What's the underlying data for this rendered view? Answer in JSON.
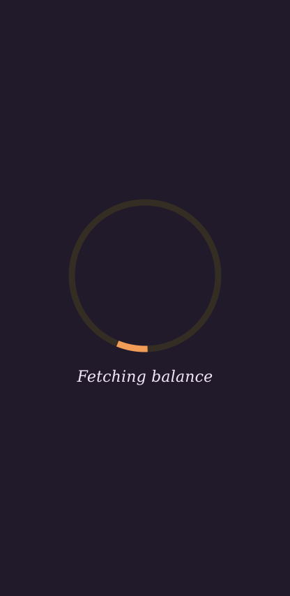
{
  "loading": {
    "status_text": "Fetching balance",
    "indicator_icon": "circular-progress-icon",
    "track_color": "#332d24",
    "arc_color": "#f29d57"
  },
  "theme": {
    "background": "#201a2b",
    "text_color": "#f1e6f7"
  }
}
